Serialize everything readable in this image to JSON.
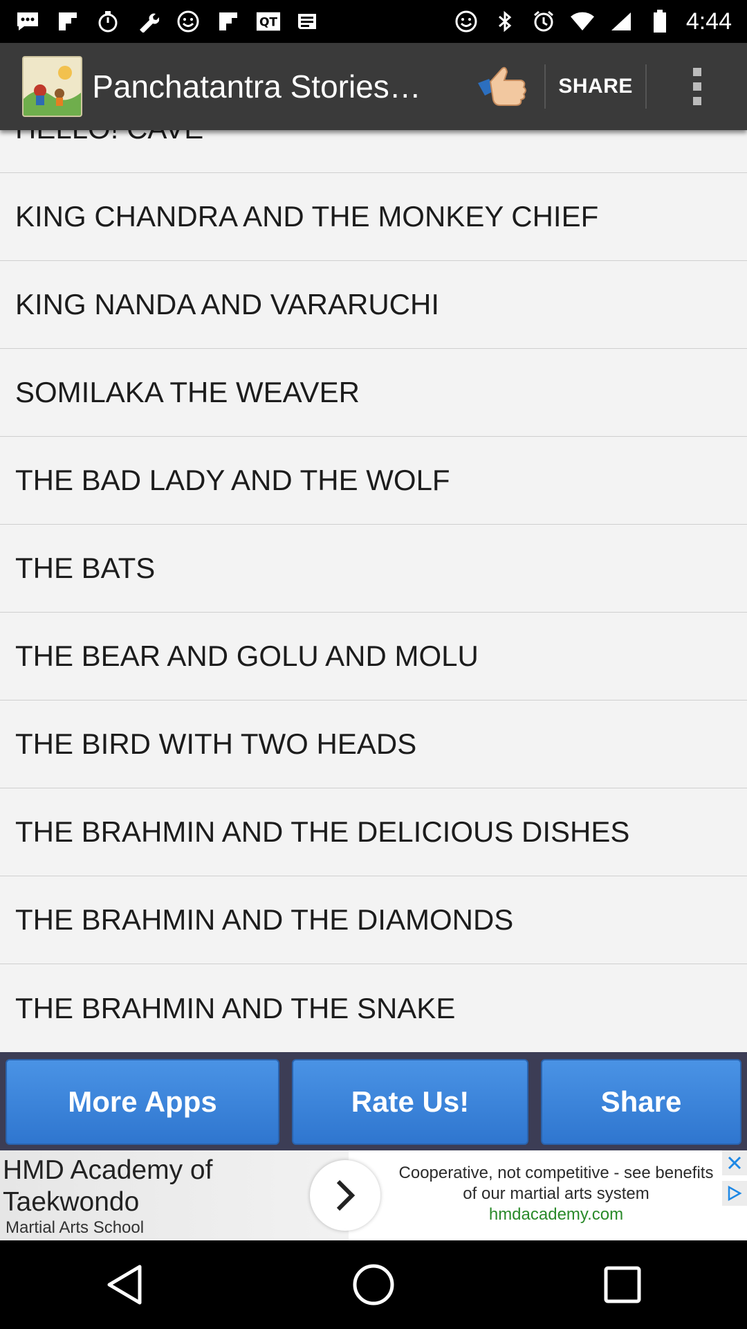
{
  "status_bar": {
    "time": "4:44",
    "icons": [
      "chat-bubble-icon",
      "flipboard-icon",
      "timer-icon",
      "wrench-icon",
      "smiley-icon",
      "flipboard-icon",
      "qt-icon",
      "newspaper-icon",
      "smiley-icon",
      "bluetooth-icon",
      "alarm-icon",
      "wifi-icon",
      "signal-icon",
      "battery-icon"
    ]
  },
  "action_bar": {
    "title": "Panchatantra Stories…",
    "share_label": "SHARE"
  },
  "stories": [
    "HELLO! CAVE",
    "KING CHANDRA AND THE MONKEY CHIEF",
    "KING NANDA AND VARARUCHI",
    "SOMILAKA THE WEAVER",
    "THE BAD LADY AND THE WOLF",
    "THE BATS",
    "THE BEAR AND GOLU AND MOLU",
    "THE BIRD WITH TWO HEADS",
    "THE BRAHMIN AND THE DELICIOUS DISHES",
    "THE BRAHMIN AND THE DIAMONDS",
    "THE BRAHMIN AND THE SNAKE"
  ],
  "bottom_buttons": {
    "more_apps": "More Apps",
    "rate_us": "Rate Us!",
    "share": "Share"
  },
  "ad": {
    "title": "HMD Academy of Taekwondo",
    "subtitle": "Martial Arts School",
    "body": "Cooperative, not competitive - see benefits of our martial arts system",
    "domain": "hmdacademy.com"
  },
  "colors": {
    "action_bar": "#3a3a3a",
    "list_bg": "#f3f3f3",
    "button_blue": "#3a85dc",
    "bottom_bar": "#3c3d55"
  }
}
